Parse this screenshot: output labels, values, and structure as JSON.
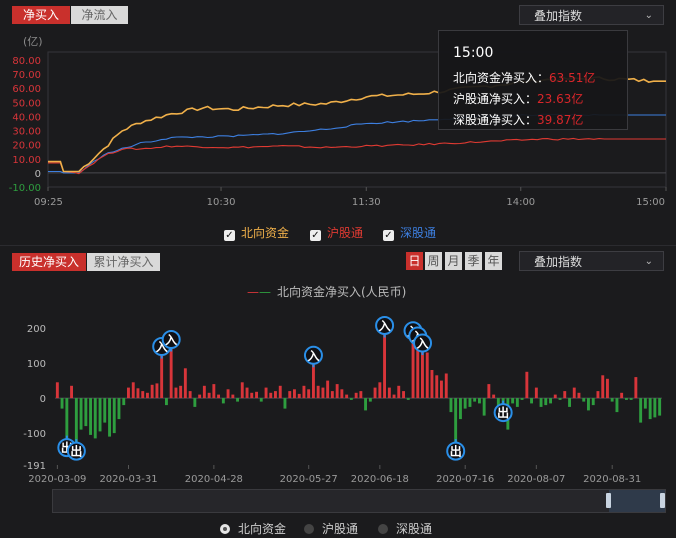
{
  "top_tabs": [
    "净买入",
    "净流入"
  ],
  "overlay_select": "叠加指数",
  "chevron_icon": "chevron-down-icon",
  "check_icon": "check-icon",
  "tooltip": {
    "time": "15:00",
    "rows": [
      {
        "label": "北向资金净买入：",
        "value": "63.51亿"
      },
      {
        "label": "沪股通净买入：",
        "value": "23.63亿"
      },
      {
        "label": "深股通净买入：",
        "value": "39.87亿"
      }
    ]
  },
  "legend_top": [
    "北向资金",
    "沪股通",
    "深股通"
  ],
  "colors": {
    "north": "#f0b04a",
    "sh": "#e03a32",
    "sz": "#3d7fe0",
    "up": "#d8353a",
    "down": "#2e9e3f",
    "marker": "#2a8fe8"
  },
  "bottom_tabs": [
    "历史净买入",
    "累计净买入"
  ],
  "period_tabs": [
    "日",
    "周",
    "月",
    "季",
    "年"
  ],
  "bottom_select": "叠加指数",
  "bottom_legend": "北向资金净买入(人民币)",
  "radios": [
    "北向资金",
    "沪股通",
    "深股通"
  ],
  "chart_data": [
    {
      "type": "line",
      "unit": "(亿)",
      "ylim": [
        -10,
        80
      ],
      "y_ticks": [
        "80.00",
        "70.00",
        "60.00",
        "50.00",
        "40.00",
        "30.00",
        "20.00",
        "10.00",
        "0",
        "-10.00"
      ],
      "x_ticks": [
        "09:25",
        "10:30",
        "11:30",
        "14:00",
        "15:00"
      ],
      "x_tick_pos": [
        0,
        0.28,
        0.515,
        0.765,
        1
      ],
      "legend": "top",
      "series": [
        {
          "name": "北向资金",
          "points": [
            [
              0,
              8
            ],
            [
              0.02,
              8
            ],
            [
              0.025,
              1
            ],
            [
              0.05,
              1
            ],
            [
              0.09,
              17
            ],
            [
              0.12,
              30
            ],
            [
              0.15,
              36
            ],
            [
              0.2,
              42
            ],
            [
              0.25,
              46
            ],
            [
              0.3,
              45
            ],
            [
              0.38,
              48
            ],
            [
              0.45,
              49
            ],
            [
              0.515,
              54
            ],
            [
              0.6,
              56
            ],
            [
              0.7,
              61
            ],
            [
              0.8,
              66
            ],
            [
              0.9,
              67
            ],
            [
              0.98,
              65
            ],
            [
              1,
              65
            ]
          ]
        },
        {
          "name": "沪股通",
          "points": [
            [
              0,
              7
            ],
            [
              0.02,
              7
            ],
            [
              0.025,
              1
            ],
            [
              0.05,
              0
            ],
            [
              0.09,
              12
            ],
            [
              0.12,
              17
            ],
            [
              0.15,
              17
            ],
            [
              0.2,
              19
            ],
            [
              0.3,
              18
            ],
            [
              0.38,
              19
            ],
            [
              0.45,
              18
            ],
            [
              0.515,
              19
            ],
            [
              0.6,
              20
            ],
            [
              0.7,
              22
            ],
            [
              0.8,
              24
            ],
            [
              0.9,
              24
            ],
            [
              1,
              24
            ]
          ]
        },
        {
          "name": "深股通",
          "points": [
            [
              0,
              1
            ],
            [
              0.02,
              1
            ],
            [
              0.025,
              0
            ],
            [
              0.05,
              0
            ],
            [
              0.09,
              13
            ],
            [
              0.12,
              17
            ],
            [
              0.15,
              21
            ],
            [
              0.2,
              25
            ],
            [
              0.3,
              26
            ],
            [
              0.38,
              28
            ],
            [
              0.45,
              31
            ],
            [
              0.515,
              35
            ],
            [
              0.6,
              37
            ],
            [
              0.7,
              40
            ],
            [
              0.8,
              41
            ],
            [
              0.9,
              41
            ],
            [
              1,
              41
            ]
          ]
        }
      ]
    },
    {
      "type": "bar",
      "title": "北向资金净买入(人民币)",
      "ylim": [
        -191,
        200
      ],
      "y_ticks": [
        "200",
        "100",
        "0",
        "-100",
        "-191"
      ],
      "x_ticks": [
        "2020-03-09",
        "2020-03-31",
        "2020-04-28",
        "2020-05-27",
        "2020-06-18",
        "2020-07-16",
        "2020-08-07",
        "2020-08-31"
      ],
      "x_tick_index": [
        0,
        15,
        33,
        53,
        68,
        86,
        101,
        117
      ],
      "values": [
        45,
        -30,
        -130,
        35,
        -140,
        -90,
        -80,
        -105,
        -115,
        -95,
        -70,
        -110,
        -100,
        -60,
        -20,
        30,
        45,
        28,
        20,
        15,
        38,
        42,
        130,
        -20,
        150,
        30,
        35,
        85,
        20,
        -25,
        10,
        35,
        15,
        40,
        10,
        -15,
        25,
        10,
        -10,
        45,
        30,
        15,
        18,
        -10,
        30,
        15,
        20,
        35,
        -30,
        20,
        25,
        12,
        35,
        25,
        105,
        35,
        30,
        50,
        20,
        40,
        25,
        10,
        -5,
        15,
        20,
        -35,
        -10,
        30,
        45,
        190,
        30,
        10,
        35,
        20,
        -5,
        175,
        160,
        140,
        130,
        80,
        65,
        50,
        70,
        -40,
        -140,
        -60,
        -30,
        -25,
        -10,
        -15,
        -50,
        40,
        10,
        -60,
        -30,
        -90,
        -15,
        -25,
        -5,
        75,
        -15,
        30,
        -25,
        -20,
        -15,
        10,
        -5,
        20,
        -25,
        30,
        15,
        -10,
        -35,
        -20,
        20,
        65,
        55,
        -10,
        -40,
        15,
        -5,
        -5,
        60,
        -70,
        -30,
        -60,
        -55,
        -50
      ]
    }
  ],
  "markers": [
    {
      "i": 2,
      "label": "出"
    },
    {
      "i": 4,
      "label": "出"
    },
    {
      "i": 22,
      "label": "入"
    },
    {
      "i": 24,
      "label": "入"
    },
    {
      "i": 54,
      "label": "入"
    },
    {
      "i": 69,
      "label": "入"
    },
    {
      "i": 75,
      "label": "入"
    },
    {
      "i": 76,
      "label": "入"
    },
    {
      "i": 77,
      "label": "入"
    },
    {
      "i": 84,
      "label": "出"
    },
    {
      "i": 94,
      "label": "出"
    }
  ]
}
